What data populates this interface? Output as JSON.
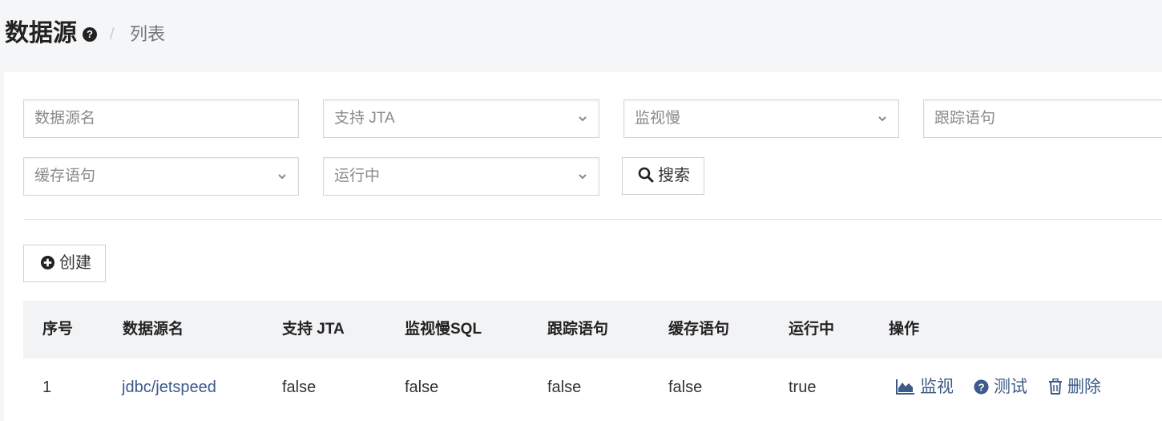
{
  "header": {
    "title": "数据源",
    "help_icon": "question-circle-icon",
    "separator": "/",
    "breadcrumb": "列表"
  },
  "filters": {
    "datasource_name_placeholder": "数据源名",
    "jta_select": "支持 JTA",
    "monitor_slow_select": "监视慢",
    "trace_statement_placeholder": "跟踪语句",
    "cache_statement_select": "缓存语句",
    "running_select": "运行中",
    "search_label": "搜索"
  },
  "toolbar": {
    "create_label": "创建"
  },
  "table": {
    "columns": [
      "序号",
      "数据源名",
      "支持 JTA",
      "监视慢SQL",
      "跟踪语句",
      "缓存语句",
      "运行中",
      "操作"
    ],
    "rows": [
      {
        "index": "1",
        "name": "jdbc/jetspeed",
        "jta": "false",
        "monitor_slow_sql": "false",
        "trace_statement": "false",
        "cache_statement": "false",
        "running": "true",
        "actions": [
          "监视",
          "测试",
          "删除"
        ]
      }
    ]
  },
  "colors": {
    "link": "#3c5a8a",
    "header_bg": "#f5f6f8",
    "table_header_bg": "#f2f3f5"
  }
}
